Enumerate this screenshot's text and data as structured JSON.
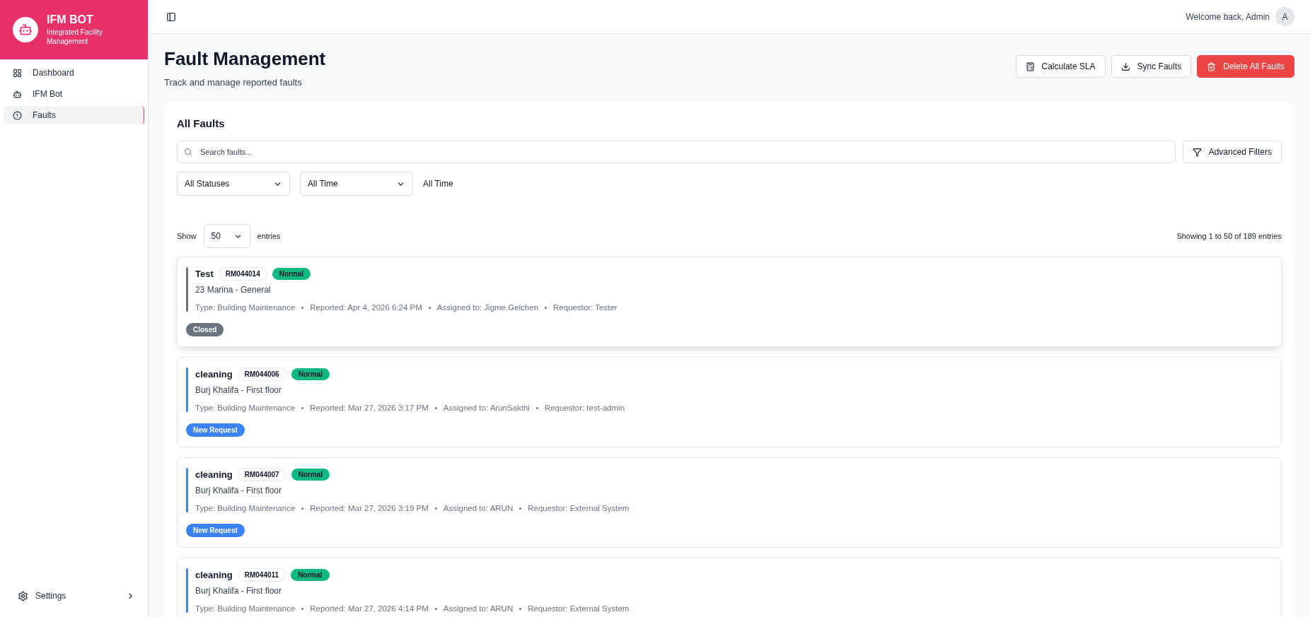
{
  "brand": {
    "title": "IFM BOT",
    "subtitle": "Integrated Facility Management"
  },
  "sidebar": {
    "items": [
      {
        "label": "Dashboard",
        "kind": "dashboard",
        "selected": false
      },
      {
        "label": "IFM Bot",
        "kind": "bot",
        "selected": false
      },
      {
        "label": "Faults",
        "kind": "alert",
        "selected": true
      }
    ],
    "footer": {
      "label": "Settings"
    }
  },
  "topbar": {
    "welcome": "Welcome back, Admin",
    "avatar": "A"
  },
  "page": {
    "title": "Fault Management",
    "subtitle": "Track and manage reported faults",
    "actions": [
      {
        "label": "Calculate SLA",
        "kind": "calculator"
      },
      {
        "label": "Sync Faults",
        "kind": "download"
      },
      {
        "label": "Delete All Faults",
        "kind": "danger"
      }
    ]
  },
  "panel": {
    "title": "All Faults",
    "search": {
      "placeholder": "Search faults..."
    },
    "advanced_filters": "Advanced Filters",
    "filters": [
      {
        "value": "All Statuses"
      },
      {
        "value": "All Time"
      }
    ],
    "range_label": "All Time",
    "show": {
      "prefix": "Show",
      "value": "50",
      "suffix": "entries"
    },
    "summary": "Showing 1 to 50 of 189 entries",
    "faults": [
      {
        "title": "Test",
        "ref": "RM044014",
        "priority": {
          "label": "Normal",
          "color": "#10b981"
        },
        "location": "23 Marina - General",
        "meta": [
          "Type: Building Maintenance",
          "Reported: Apr 4, 2026 6:24 PM",
          "Assigned to: Jigme.Gelchen",
          "Requestor: Tester"
        ],
        "status": {
          "label": "Closed",
          "color": "#6b7280"
        }
      },
      {
        "title": "cleaning",
        "ref": "RM044006",
        "priority": {
          "label": "Normal",
          "color": "#10b981"
        },
        "location": "Burj Khalifa - First floor",
        "meta": [
          "Type: Building Maintenance",
          "Reported: Mar 27, 2026 3:17 PM",
          "Assigned to: ArunSakthi",
          "Requestor: test-admin"
        ],
        "status": {
          "label": "New Request",
          "color": "#3b82f6"
        }
      },
      {
        "title": "cleaning",
        "ref": "RM044007",
        "priority": {
          "label": "Normal",
          "color": "#10b981"
        },
        "location": "Burj Khalifa - First floor",
        "meta": [
          "Type: Building Maintenance",
          "Reported: Mar 27, 2026 3:19 PM",
          "Assigned to: ARUN",
          "Requestor: External System"
        ],
        "status": {
          "label": "New Request",
          "color": "#3b82f6"
        }
      },
      {
        "title": "cleaning",
        "ref": "RM044011",
        "priority": {
          "label": "Normal",
          "color": "#10b981"
        },
        "location": "Burj Khalifa - First floor",
        "meta": [
          "Type: Building Maintenance",
          "Reported: Mar 27, 2026 4:14 PM",
          "Assigned to: ARUN",
          "Requestor: External System"
        ]
      }
    ]
  }
}
